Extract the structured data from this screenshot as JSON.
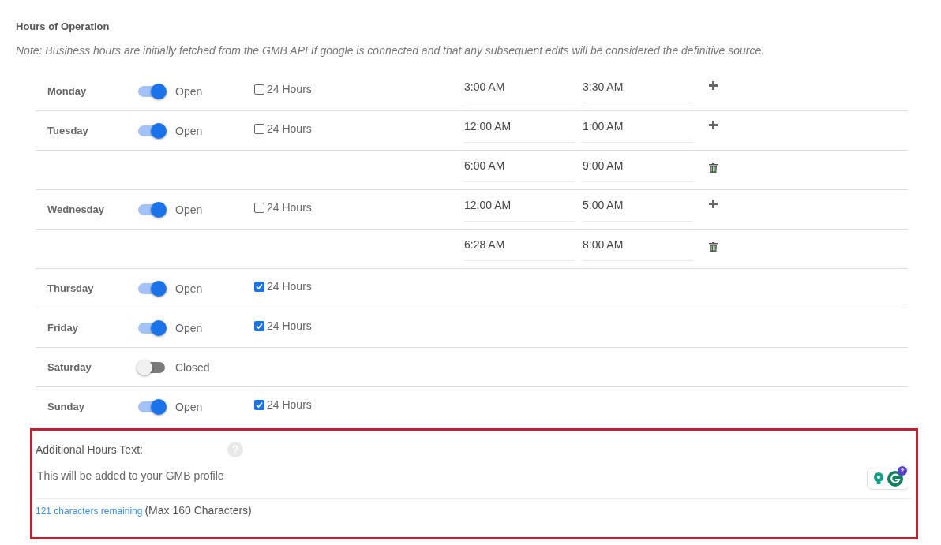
{
  "section": {
    "title": "Hours of Operation",
    "note": "Note: Business hours are initially fetched from the GMB API If google is connected and that any subsequent edits will be considered the definitive source."
  },
  "rows": [
    {
      "kind": "day",
      "day": "Monday",
      "on": true,
      "status": "Open",
      "all_day": {
        "label": "24 Hours",
        "checked": false
      },
      "from": "3:00 AM",
      "to": "3:30 AM",
      "action": {
        "kind": "add"
      }
    },
    {
      "kind": "day",
      "day": "Tuesday",
      "on": true,
      "status": "Open",
      "all_day": {
        "label": "24 Hours",
        "checked": false
      },
      "from": "12:00 AM",
      "to": "1:00 AM",
      "action": {
        "kind": "add"
      }
    },
    {
      "kind": "extra",
      "from": "6:00 AM",
      "to": "9:00 AM",
      "action": {
        "kind": "delete"
      }
    },
    {
      "kind": "day",
      "day": "Wednesday",
      "on": true,
      "status": "Open",
      "all_day": {
        "label": "24 Hours",
        "checked": false
      },
      "from": "12:00 AM",
      "to": "5:00 AM",
      "action": {
        "kind": "add"
      }
    },
    {
      "kind": "extra",
      "from": "6:28 AM",
      "to": "8:00 AM",
      "action": {
        "kind": "delete"
      }
    },
    {
      "kind": "day",
      "day": "Thursday",
      "on": true,
      "status": "Open",
      "all_day": {
        "label": "24 Hours",
        "checked": true
      }
    },
    {
      "kind": "day",
      "day": "Friday",
      "on": true,
      "status": "Open",
      "all_day": {
        "label": "24 Hours",
        "checked": true
      }
    },
    {
      "kind": "day",
      "day": "Saturday",
      "on": false,
      "status": "Closed"
    },
    {
      "kind": "day",
      "day": "Sunday",
      "on": true,
      "status": "Open",
      "all_day": {
        "label": "24 Hours",
        "checked": true
      }
    }
  ],
  "additional": {
    "label": "Additional Hours Text:",
    "value": "This will be added to your GMB profile",
    "remaining": "121 characters remaining",
    "max": "(Max 160 Characters)",
    "grammarly_count": "2"
  }
}
